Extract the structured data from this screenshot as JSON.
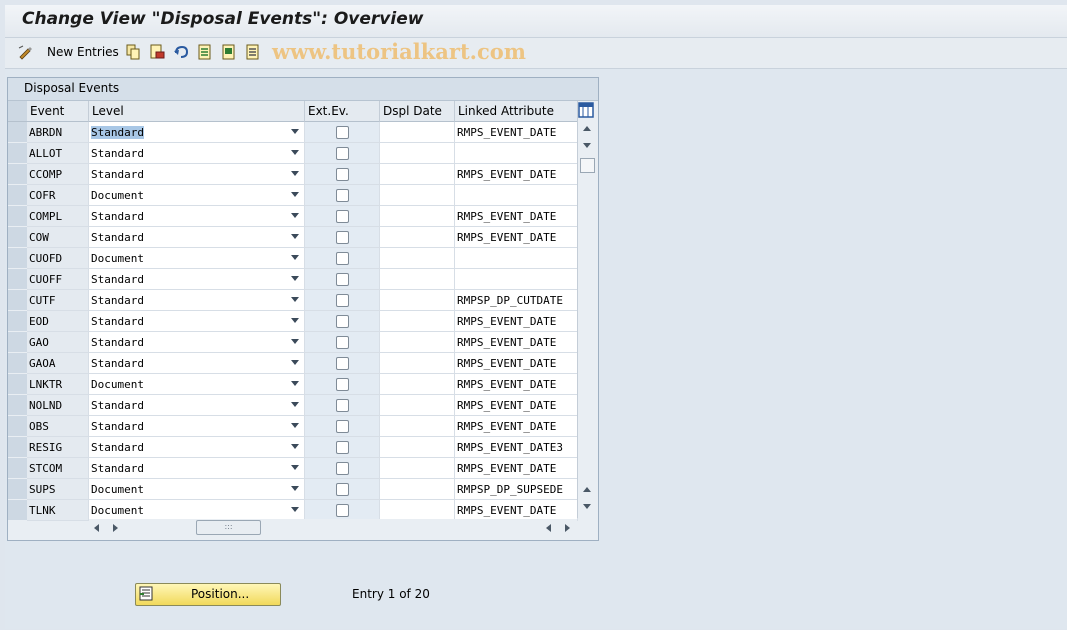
{
  "window": {
    "title": "Change View \"Disposal Events\": Overview"
  },
  "toolbar": {
    "new_entries_label": "New Entries",
    "watermark": "www.tutorialkart.com",
    "icons": [
      "change-display-icon",
      "copy-icon",
      "delete-icon",
      "undo-icon",
      "select-all-icon",
      "select-block-icon",
      "deselect-all-icon"
    ]
  },
  "panel": {
    "title": "Disposal Events"
  },
  "table": {
    "columns": [
      "Event",
      "Level",
      "Ext.Ev.",
      "Dspl Date",
      "Linked Attribute"
    ],
    "rows": [
      {
        "event": "ABRDN",
        "level": "Standard",
        "ext": false,
        "date": "",
        "attr": "RMPS_EVENT_DATE"
      },
      {
        "event": "ALLOT",
        "level": "Standard",
        "ext": false,
        "date": "",
        "attr": ""
      },
      {
        "event": "CCOMP",
        "level": "Standard",
        "ext": false,
        "date": "",
        "attr": "RMPS_EVENT_DATE"
      },
      {
        "event": "COFR",
        "level": "Document",
        "ext": false,
        "date": "",
        "attr": ""
      },
      {
        "event": "COMPL",
        "level": "Standard",
        "ext": false,
        "date": "",
        "attr": "RMPS_EVENT_DATE"
      },
      {
        "event": "COW",
        "level": "Standard",
        "ext": false,
        "date": "",
        "attr": "RMPS_EVENT_DATE"
      },
      {
        "event": "CUOFD",
        "level": "Document",
        "ext": false,
        "date": "",
        "attr": ""
      },
      {
        "event": "CUOFF",
        "level": "Standard",
        "ext": false,
        "date": "",
        "attr": ""
      },
      {
        "event": "CUTF",
        "level": "Standard",
        "ext": false,
        "date": "",
        "attr": "RMPSP_DP_CUTDATE"
      },
      {
        "event": "EOD",
        "level": "Standard",
        "ext": false,
        "date": "",
        "attr": "RMPS_EVENT_DATE"
      },
      {
        "event": "GAO",
        "level": "Standard",
        "ext": false,
        "date": "",
        "attr": "RMPS_EVENT_DATE"
      },
      {
        "event": "GAOA",
        "level": "Standard",
        "ext": false,
        "date": "",
        "attr": "RMPS_EVENT_DATE"
      },
      {
        "event": "LNKTR",
        "level": "Document",
        "ext": false,
        "date": "",
        "attr": "RMPS_EVENT_DATE"
      },
      {
        "event": "NOLND",
        "level": "Standard",
        "ext": false,
        "date": "",
        "attr": "RMPS_EVENT_DATE"
      },
      {
        "event": "OBS",
        "level": "Standard",
        "ext": false,
        "date": "",
        "attr": "RMPS_EVENT_DATE"
      },
      {
        "event": "RESIG",
        "level": "Standard",
        "ext": false,
        "date": "",
        "attr": "RMPS_EVENT_DATE3"
      },
      {
        "event": "STCOM",
        "level": "Standard",
        "ext": false,
        "date": "",
        "attr": "RMPS_EVENT_DATE"
      },
      {
        "event": "SUPS",
        "level": "Document",
        "ext": false,
        "date": "",
        "attr": "RMPSP_DP_SUPSEDE"
      },
      {
        "event": "TLNK",
        "level": "Document",
        "ext": false,
        "date": "",
        "attr": "RMPS_EVENT_DATE"
      }
    ]
  },
  "footer": {
    "position_label": "Position...",
    "entry_text": "Entry 1 of 20"
  },
  "colors": {
    "accent_button": "#f1d95b",
    "watermark": "#f2a52a"
  }
}
